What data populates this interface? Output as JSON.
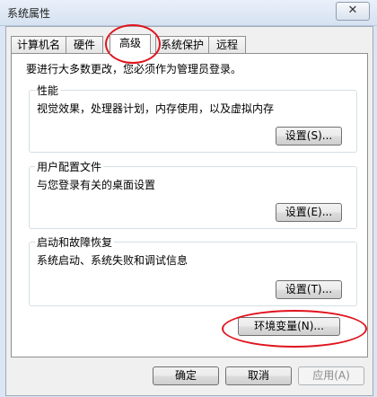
{
  "window": {
    "title": "系统属性",
    "close_label": "✕"
  },
  "tabs": [
    "计算机名",
    "硬件",
    "高级",
    "系统保护",
    "远程"
  ],
  "active_tab": "高级",
  "notice": "要进行大多数更改，您必须作为管理员登录。",
  "groups": {
    "performance": {
      "title": "性能",
      "desc": "视觉效果，处理器计划，内存使用，以及虚拟内存",
      "button": "设置(S)..."
    },
    "user_profiles": {
      "title": "用户配置文件",
      "desc": "与您登录有关的桌面设置",
      "button": "设置(E)..."
    },
    "startup_recovery": {
      "title": "启动和故障恢复",
      "desc": "系统启动、系统失败和调试信息",
      "button": "设置(T)..."
    }
  },
  "env_button": "环境变量(N)...",
  "footer": {
    "ok": "确定",
    "cancel": "取消",
    "apply": "应用(A)"
  },
  "annotation_color": "#e0141e"
}
